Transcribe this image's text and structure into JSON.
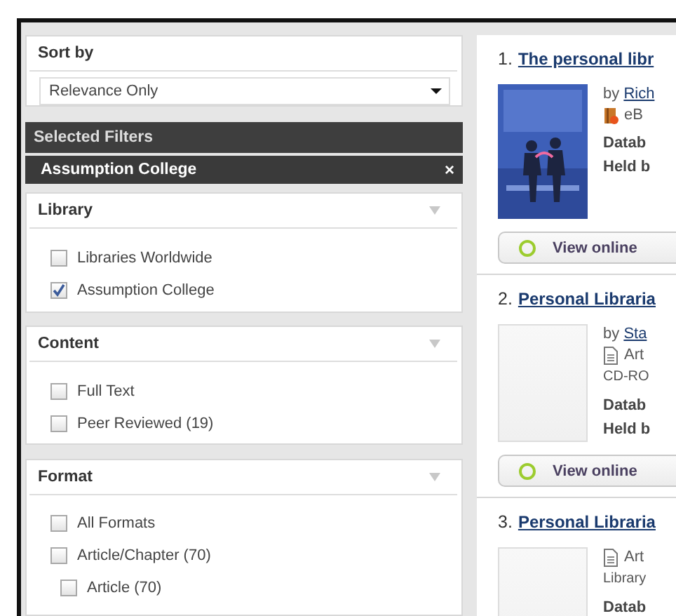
{
  "sort": {
    "label": "Sort by",
    "value": "Relevance Only"
  },
  "selected_filters": {
    "title": "Selected Filters",
    "items": [
      {
        "label": "Assumption College",
        "remove": "×"
      }
    ]
  },
  "facets": [
    {
      "title": "Library",
      "options": [
        {
          "label": "Libraries Worldwide",
          "checked": false
        },
        {
          "label": "Assumption College",
          "checked": true
        }
      ]
    },
    {
      "title": "Content",
      "options": [
        {
          "label": "Full Text",
          "checked": false
        },
        {
          "label": "Peer Reviewed (19)",
          "checked": false
        }
      ]
    },
    {
      "title": "Format",
      "options": [
        {
          "label": "All Formats",
          "checked": false
        },
        {
          "label": "Article/Chapter (70)",
          "checked": false,
          "children": [
            {
              "label": "Article (70)",
              "checked": false
            }
          ]
        }
      ]
    }
  ],
  "results": [
    {
      "number": "1.",
      "title": "The personal libr",
      "cover": {
        "kind": "picture"
      },
      "details": [
        {
          "kind": "author",
          "prefix": "by",
          "name": "Rich"
        },
        {
          "kind": "ebook",
          "text": "eB"
        },
        {
          "kind": "field",
          "text": "Datab"
        },
        {
          "kind": "field",
          "text": "Held b"
        }
      ],
      "action": "View online"
    },
    {
      "number": "2.",
      "title": "Personal Libraria",
      "cover": {
        "kind": "blank"
      },
      "details": [
        {
          "kind": "author",
          "prefix": "by",
          "name": "Sta"
        },
        {
          "kind": "article",
          "text": "Art"
        },
        {
          "kind": "note",
          "text": "CD-RO"
        },
        {
          "kind": "field",
          "text": "Datab"
        },
        {
          "kind": "field",
          "text": "Held b"
        }
      ],
      "action": "View online"
    },
    {
      "number": "3.",
      "title": "Personal Libraria",
      "cover": {
        "kind": "blank"
      },
      "details": [
        {
          "kind": "article",
          "text": "Art"
        },
        {
          "kind": "note",
          "text": "Library"
        },
        {
          "kind": "field",
          "text": "Datab"
        }
      ]
    }
  ]
}
